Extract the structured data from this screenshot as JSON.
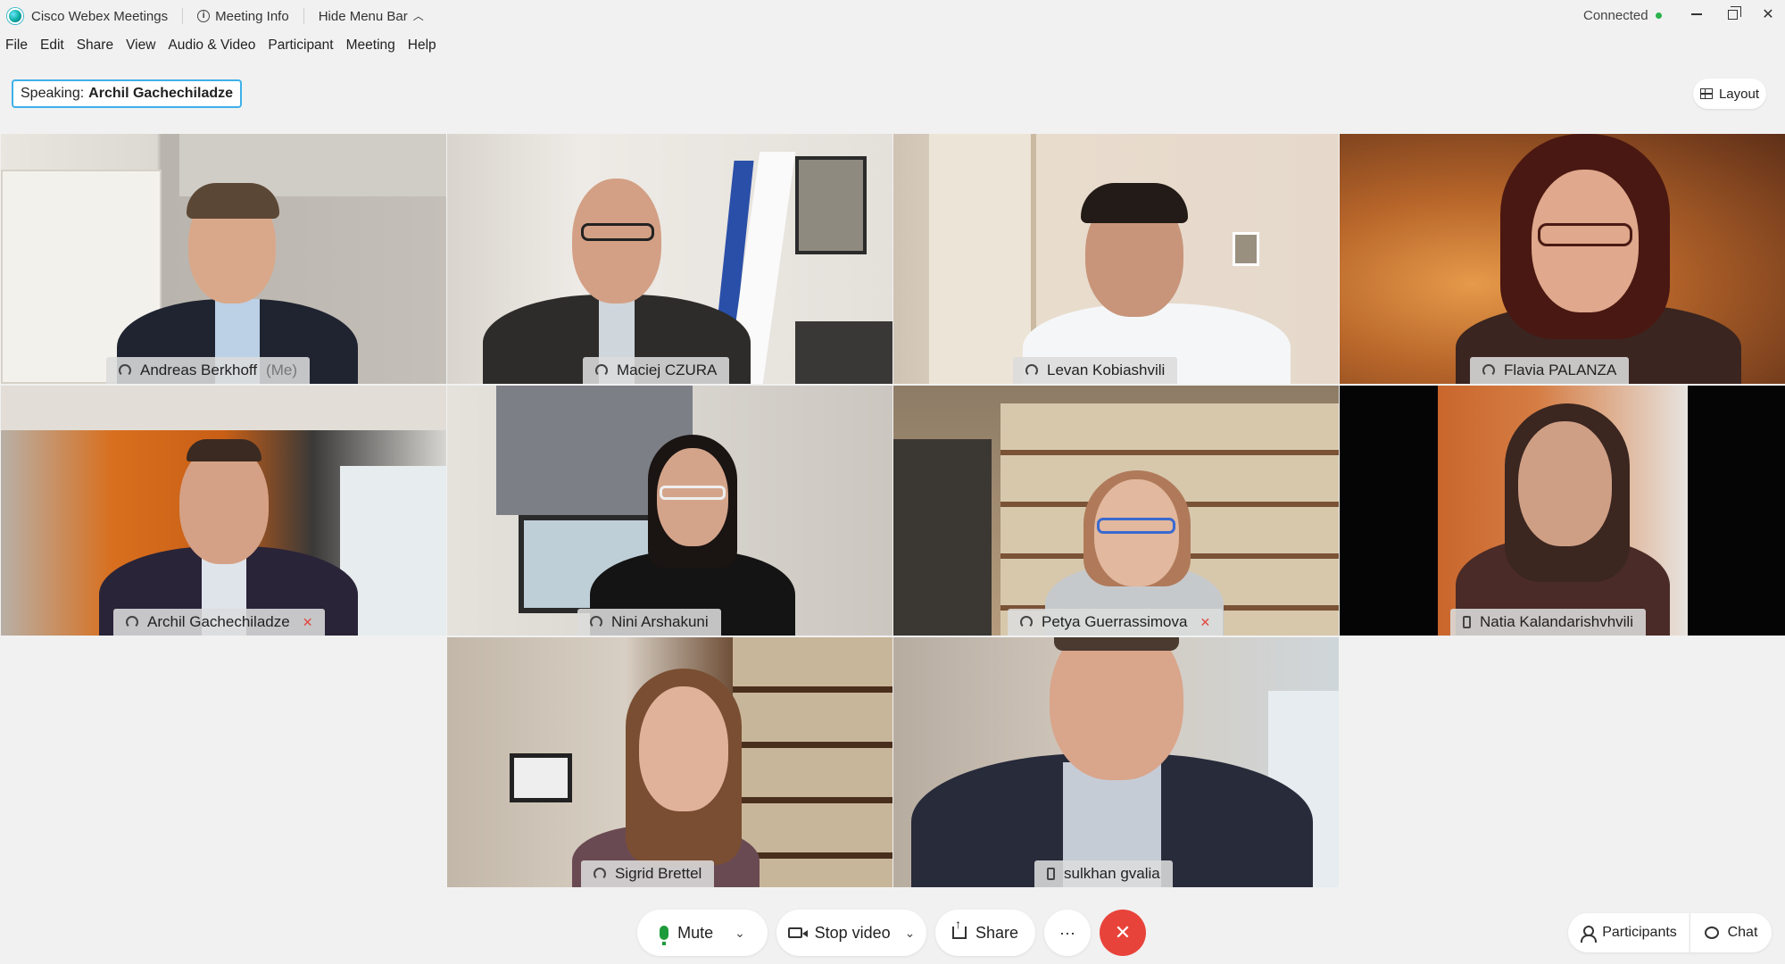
{
  "titlebar": {
    "app_name": "Cisco Webex Meetings",
    "meeting_info": "Meeting Info",
    "hide_menu": "Hide Menu Bar",
    "status": "Connected"
  },
  "menu": [
    "File",
    "Edit",
    "Share",
    "View",
    "Audio & Video",
    "Participant",
    "Meeting",
    "Help"
  ],
  "speaking": {
    "label": "Speaking:",
    "name": "Archil Gachechiladze"
  },
  "layout_label": "Layout",
  "participants": [
    {
      "name": "Andreas Berkhoff",
      "suffix": "(Me)",
      "audio": "headset-icon",
      "muted": false
    },
    {
      "name": "Maciej CZURA",
      "suffix": "",
      "audio": "headset-icon",
      "muted": false
    },
    {
      "name": "Levan Kobiashvili",
      "suffix": "",
      "audio": "headset-icon",
      "muted": false
    },
    {
      "name": "Flavia PALANZA",
      "suffix": "",
      "audio": "headset-icon",
      "muted": false
    },
    {
      "name": "Archil Gachechiladze",
      "suffix": "",
      "audio": "headset-icon",
      "muted": true
    },
    {
      "name": "Nini Arshakuni",
      "suffix": "",
      "audio": "headset-icon",
      "muted": false
    },
    {
      "name": "Petya Guerrassimova",
      "suffix": "",
      "audio": "headset-icon",
      "muted": true
    },
    {
      "name": "Natia Kalandarishvhvili",
      "suffix": "",
      "audio": "phone-icon",
      "muted": false
    },
    {
      "name": "Sigrid Brettel",
      "suffix": "",
      "audio": "headset-icon",
      "muted": false
    },
    {
      "name": "sulkhan gvalia",
      "suffix": "",
      "audio": "phone-icon",
      "muted": false
    }
  ],
  "controls": {
    "mute": "Mute",
    "stop_video": "Stop video",
    "share": "Share",
    "more": "···",
    "end": "✕",
    "participants": "Participants",
    "chat": "Chat"
  },
  "colors": {
    "accent": "#3fb0e8",
    "end_call": "#e8433a",
    "connected": "#2bb24c"
  }
}
